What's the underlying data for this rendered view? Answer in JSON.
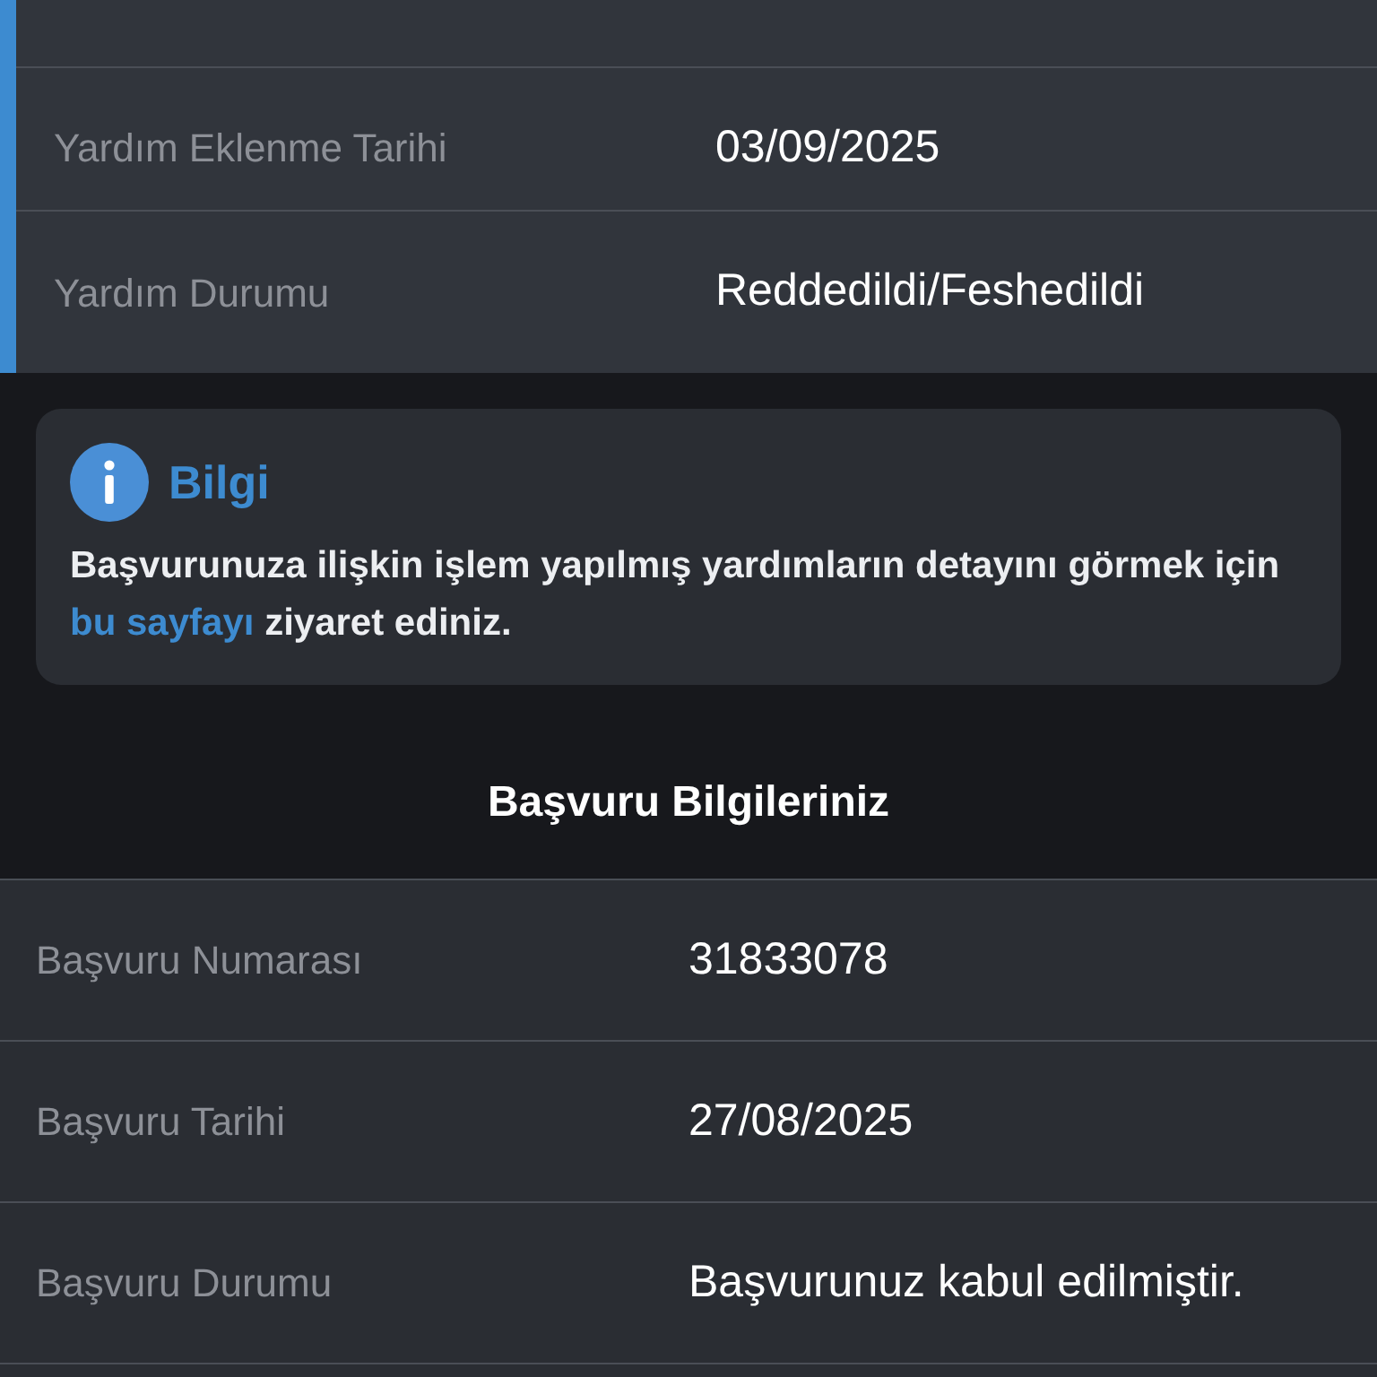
{
  "aid_details": {
    "rows": [
      {
        "label": "Yardım Eklenme Tarihi",
        "value": "03/09/2025"
      },
      {
        "label": "Yardım Durumu",
        "value": "Reddedildi/Feshedildi"
      }
    ]
  },
  "info_box": {
    "title": "Bilgi",
    "text": "Başvurunuza ilişkin işlem yapılmış yardımların detayını görmek için",
    "link": "bu sayfayı",
    "text_after": "ziyaret ediniz."
  },
  "application": {
    "title": "Başvuru Bilgileriniz",
    "rows": [
      {
        "label": "Başvuru Numarası",
        "value": "31833078"
      },
      {
        "label": "Başvuru Tarihi",
        "value": "27/08/2025"
      },
      {
        "label": "Başvuru Durumu",
        "value": "Başvurunuz kabul edilmiştir."
      }
    ]
  }
}
